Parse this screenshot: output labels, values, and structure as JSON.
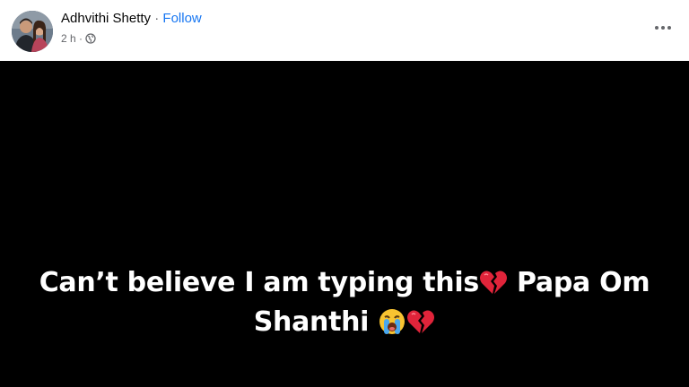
{
  "post": {
    "author_name": "Adhvithi Shetty",
    "separator": " · ",
    "follow_label": "Follow",
    "timestamp": "2 h ·",
    "privacy_icon": "globe-icon",
    "more_icon": "more-options-icon",
    "text_line1_part1": "Can’t believe I am typing this",
    "text_line1_part2": " Papa Om",
    "text_line2": "Shanthi ",
    "emojis": [
      "broken-heart-icon",
      "crying-face-icon",
      "broken-heart-icon"
    ],
    "background_color": "#000000",
    "text_color": "#ffffff",
    "link_color": "#1877f2"
  }
}
